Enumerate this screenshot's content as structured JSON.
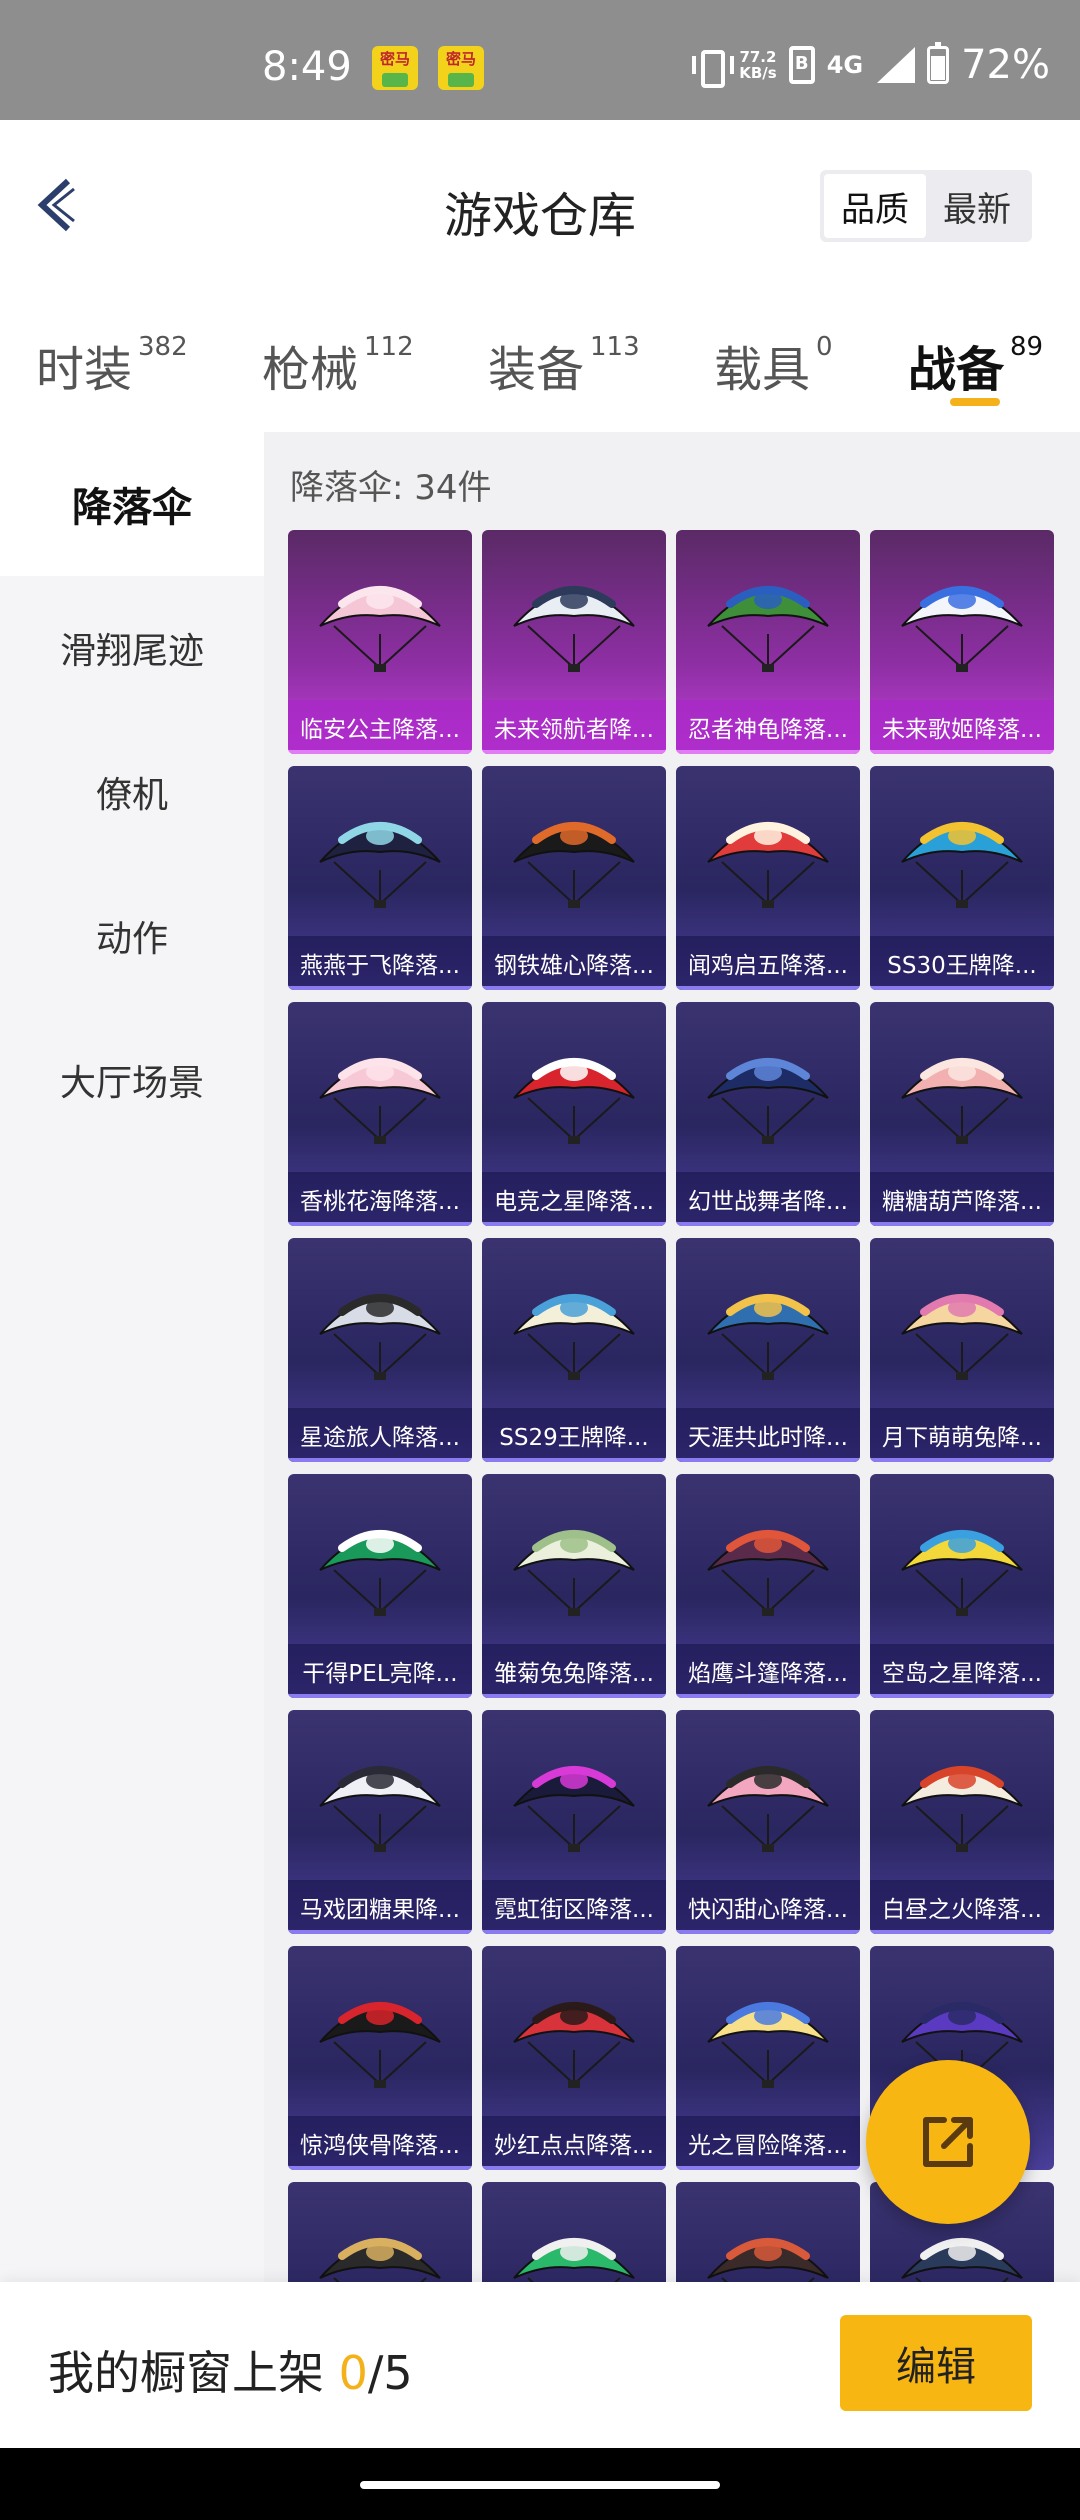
{
  "status": {
    "time": "8:49",
    "notifications": [
      "密马",
      "密马"
    ],
    "net_speed_value": "77.2",
    "net_speed_unit": "KB/s",
    "sim_label": "B",
    "network": "4G",
    "battery": "72%"
  },
  "header": {
    "title": "游戏仓库",
    "sort_quality": "品质",
    "sort_newest": "最新"
  },
  "tabs": [
    {
      "label": "时装",
      "count": "382"
    },
    {
      "label": "枪械",
      "count": "112"
    },
    {
      "label": "装备",
      "count": "113"
    },
    {
      "label": "载具",
      "count": "0"
    },
    {
      "label": "战备",
      "count": "89"
    }
  ],
  "sidebar": {
    "items": [
      "降落伞",
      "滑翔尾迹",
      "僚机",
      "动作",
      "大厅场景"
    ]
  },
  "content": {
    "count_label": "降落伞: 34件"
  },
  "items": [
    {
      "name": "临安公主降落...",
      "rarity": "legendary",
      "colors": [
        "#f4c6d6",
        "#fbe6ee"
      ]
    },
    {
      "name": "未来领航者降...",
      "rarity": "legendary",
      "colors": [
        "#e9eef5",
        "#2d3a5a"
      ]
    },
    {
      "name": "忍者神龟降落...",
      "rarity": "legendary",
      "colors": [
        "#3f8f3a",
        "#2a5fc0"
      ]
    },
    {
      "name": "未来歌姬降落...",
      "rarity": "legendary",
      "colors": [
        "#f3f5fb",
        "#3a6fe0"
      ]
    },
    {
      "name": "燕燕于飞降落...",
      "rarity": "epic",
      "colors": [
        "#1e2140",
        "#8fd6e6"
      ]
    },
    {
      "name": "钢铁雄心降落...",
      "rarity": "epic",
      "colors": [
        "#1a1a1a",
        "#e06a2a"
      ]
    },
    {
      "name": "闻鸡启五降落...",
      "rarity": "epic",
      "colors": [
        "#e23b3b",
        "#fff3e0"
      ]
    },
    {
      "name": "SS30王牌降...",
      "rarity": "epic",
      "colors": [
        "#2aa0d8",
        "#f2c230"
      ]
    },
    {
      "name": "香桃花海降落...",
      "rarity": "epic",
      "colors": [
        "#f7c9d6",
        "#fde3ea"
      ]
    },
    {
      "name": "电竞之星降落...",
      "rarity": "epic",
      "colors": [
        "#d8242c",
        "#ffffff"
      ]
    },
    {
      "name": "幻世战舞者降...",
      "rarity": "epic",
      "colors": [
        "#1e2c66",
        "#5e86d8"
      ]
    },
    {
      "name": "糖糖葫芦降落...",
      "rarity": "epic",
      "colors": [
        "#f2b0b0",
        "#fbe6e0"
      ]
    },
    {
      "name": "星途旅人降落...",
      "rarity": "epic",
      "colors": [
        "#d8dce6",
        "#2a2a2a"
      ]
    },
    {
      "name": "SS29王牌降...",
      "rarity": "epic",
      "colors": [
        "#f4efd8",
        "#4aa0d8"
      ]
    },
    {
      "name": "天涯共此时降...",
      "rarity": "epic",
      "colors": [
        "#2f6fb0",
        "#f2c24a"
      ]
    },
    {
      "name": "月下萌萌兔降...",
      "rarity": "epic",
      "colors": [
        "#f5d6a0",
        "#e27ab0"
      ]
    },
    {
      "name": "干得PEL亮降...",
      "rarity": "epic",
      "colors": [
        "#1a9a5a",
        "#ffffff"
      ]
    },
    {
      "name": "雏菊兔兔降落...",
      "rarity": "epic",
      "colors": [
        "#eaf0dc",
        "#9fc08a"
      ]
    },
    {
      "name": "焰鹰斗篷降落...",
      "rarity": "epic",
      "colors": [
        "#5a2a4a",
        "#e0563a"
      ]
    },
    {
      "name": "空岛之星降落...",
      "rarity": "epic",
      "colors": [
        "#f2d83a",
        "#3aa0e0"
      ]
    },
    {
      "name": "马戏团糖果降...",
      "rarity": "epic",
      "colors": [
        "#eef0f6",
        "#2a2a36"
      ]
    },
    {
      "name": "霓虹街区降落...",
      "rarity": "epic",
      "colors": [
        "#1a1a3a",
        "#d83ad8"
      ]
    },
    {
      "name": "快闪甜心降落...",
      "rarity": "epic",
      "colors": [
        "#f2a6c0",
        "#2a2a2a"
      ]
    },
    {
      "name": "白昼之火降落...",
      "rarity": "epic",
      "colors": [
        "#f5ece0",
        "#d8442a"
      ]
    },
    {
      "name": "惊鸿侠骨降落...",
      "rarity": "epic",
      "colors": [
        "#1a1a1a",
        "#d8242c"
      ]
    },
    {
      "name": "妙红点点降落...",
      "rarity": "epic",
      "colors": [
        "#d8323a",
        "#2a1a1a"
      ]
    },
    {
      "name": "光之冒险降落...",
      "rarity": "epic",
      "colors": [
        "#f8e08a",
        "#4a7ae0"
      ]
    },
    {
      "name": "",
      "rarity": "epic",
      "colors": [
        "#5a3ac0",
        "#2a2a66"
      ]
    },
    {
      "name": "",
      "rarity": "epic",
      "colors": [
        "#2a2a2a",
        "#d8b060"
      ]
    },
    {
      "name": "",
      "rarity": "epic",
      "colors": [
        "#2ab86a",
        "#f0f0f0"
      ]
    },
    {
      "name": "",
      "rarity": "epic",
      "colors": [
        "#3a2a2a",
        "#d85a3a"
      ]
    },
    {
      "name": "",
      "rarity": "epic",
      "colors": [
        "#2a3a5a",
        "#f0f0f0"
      ]
    }
  ],
  "bottom": {
    "label_prefix": "我的橱窗上架 ",
    "current": "0",
    "total": "/5",
    "edit_label": "编辑"
  },
  "colors": {
    "accent": "#f7b611",
    "legendary_card": "#a13dc0",
    "epic_card": "#3a3474"
  },
  "icons": [
    "back-icon",
    "share-external-icon",
    "vibrate-icon",
    "signal-icon",
    "battery-icon"
  ]
}
